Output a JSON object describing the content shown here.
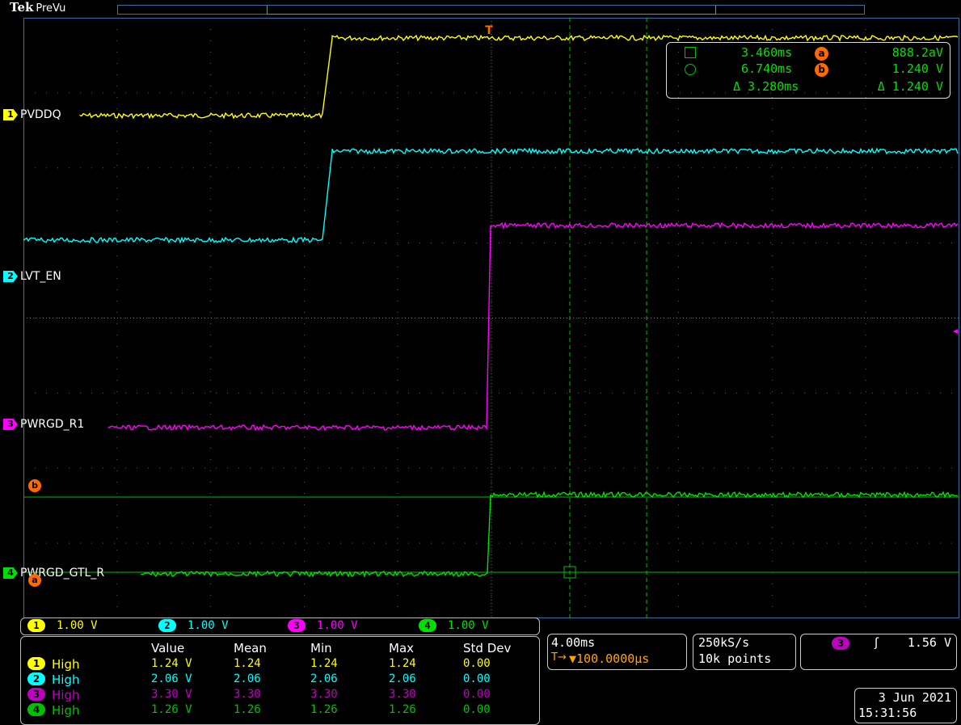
{
  "brand": {
    "logo": "Tek",
    "mode": "PreVu"
  },
  "channels": [
    {
      "num": "1",
      "name": "PVDDQ",
      "color": "#ffff00",
      "scale": "1.00 V"
    },
    {
      "num": "2",
      "name": "LVT_EN",
      "color": "#00ffff",
      "scale": "1.00 V"
    },
    {
      "num": "3",
      "name": "PWRGD_R1",
      "color": "#ff00ff",
      "scale": "1.00 V"
    },
    {
      "num": "4",
      "name": "PWRGD_GTL_R",
      "color": "#00e000",
      "scale": "1.00 V"
    }
  ],
  "markers": {
    "a": "a",
    "b": "b",
    "trigger": "T"
  },
  "cursor_readout": {
    "t1": "3.460ms",
    "v1": "888.2aV",
    "t2": "6.740ms",
    "v2": "1.240 V",
    "dt": "Δ 3.280ms",
    "dv": "Δ 1.240 V"
  },
  "measurements": {
    "headers": [
      "Value",
      "Mean",
      "Min",
      "Max",
      "Std Dev"
    ],
    "rows": [
      {
        "ch": "1",
        "label": "High",
        "value": "1.24 V",
        "mean": "1.24",
        "min": "1.24",
        "max": "1.24",
        "std": "0.00",
        "color": "#ffff00"
      },
      {
        "ch": "2",
        "label": "High",
        "value": "2.06 V",
        "mean": "2.06",
        "min": "2.06",
        "max": "2.06",
        "std": "0.00",
        "color": "#00ffff"
      },
      {
        "ch": "3",
        "label": "High",
        "value": "3.30 V",
        "mean": "3.30",
        "min": "3.30",
        "max": "3.30",
        "std": "0.00",
        "color": "#c000c0"
      },
      {
        "ch": "4",
        "label": "High",
        "value": "1.26 V",
        "mean": "1.26",
        "min": "1.26",
        "max": "1.26",
        "std": "0.00",
        "color": "#00c000"
      }
    ]
  },
  "timebase": {
    "scale": "4.00ms",
    "position": "▼100.0000µs",
    "pos_icon": "T→"
  },
  "acquisition": {
    "rate": "250kS/s",
    "record": "10k points"
  },
  "trigger": {
    "source": "3",
    "slope_icon": "ʃ",
    "level": "1.56 V"
  },
  "datetime": {
    "date": "3 Jun 2021",
    "time": "15:31:56"
  },
  "colors": {
    "grid": "#5a5a5a",
    "cursor": "#00c000",
    "orange": "#ff6a00",
    "frame": "#3a6ea5"
  }
}
